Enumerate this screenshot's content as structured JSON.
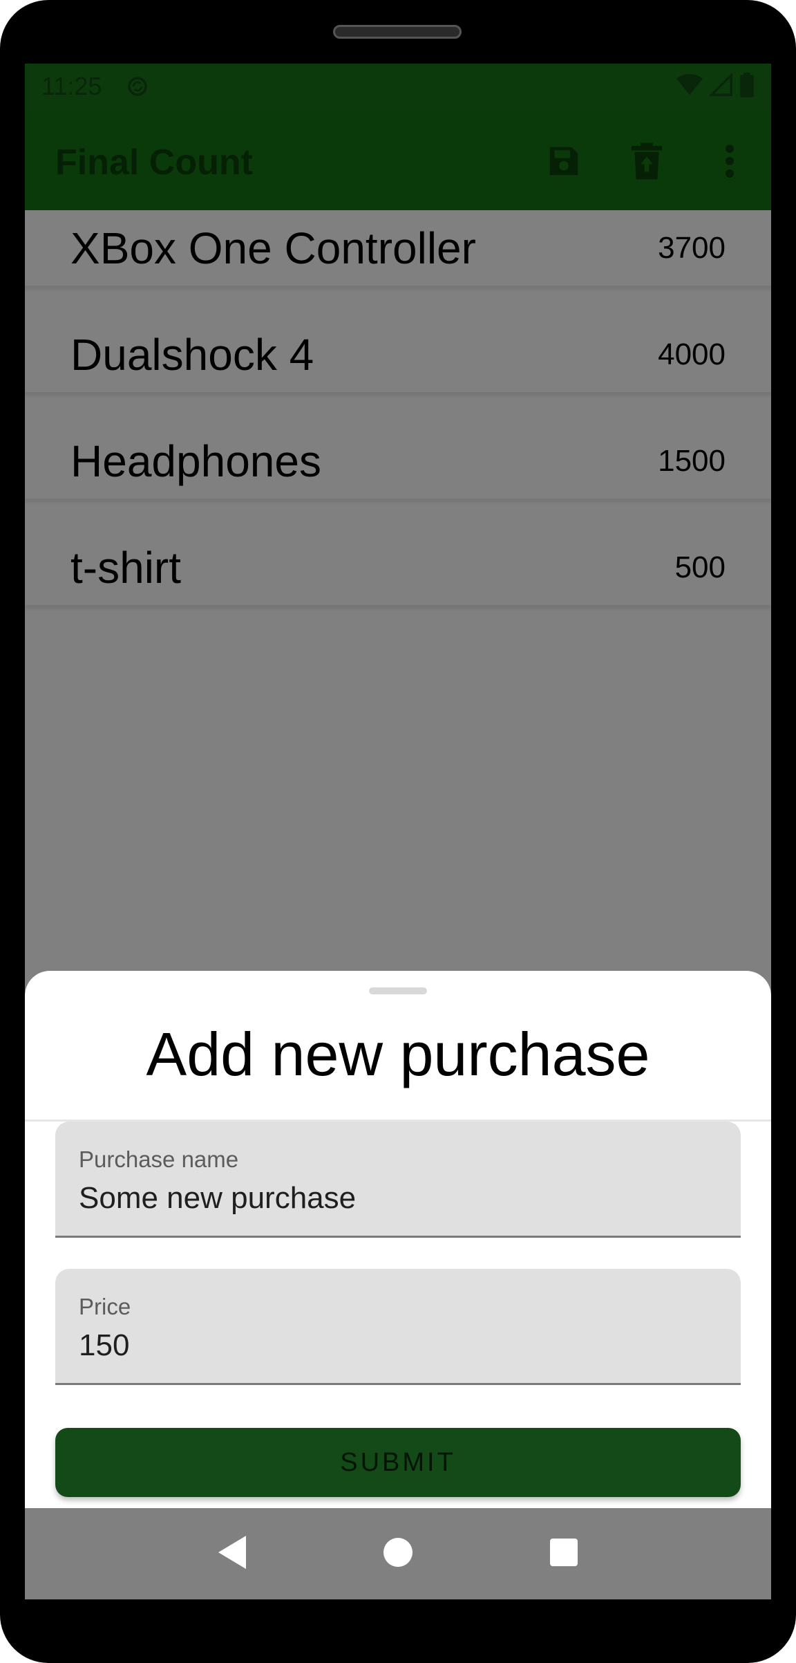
{
  "status_bar": {
    "time": "11:25",
    "icons": [
      "sync-icon",
      "wifi-icon",
      "signal-icon",
      "battery-icon"
    ]
  },
  "app_bar": {
    "title": "Final Count",
    "actions": [
      "save-icon",
      "delete-upload-icon",
      "more-vert-icon"
    ]
  },
  "purchases": [
    {
      "name": "XBox One Controller",
      "price": "3700"
    },
    {
      "name": "Dualshock 4",
      "price": "4000"
    },
    {
      "name": "Headphones",
      "price": "1500"
    },
    {
      "name": "t-shirt",
      "price": "500"
    }
  ],
  "sheet": {
    "title": "Add new purchase",
    "name_field": {
      "label": "Purchase name",
      "value": "Some new purchase"
    },
    "price_field": {
      "label": "Price",
      "value": "150"
    },
    "submit_label": "SUBMIT"
  },
  "nav_bar": {
    "buttons": [
      "back-icon",
      "home-icon",
      "recents-icon"
    ]
  },
  "colors": {
    "primary": "#134a17",
    "scrim": "#808080"
  }
}
